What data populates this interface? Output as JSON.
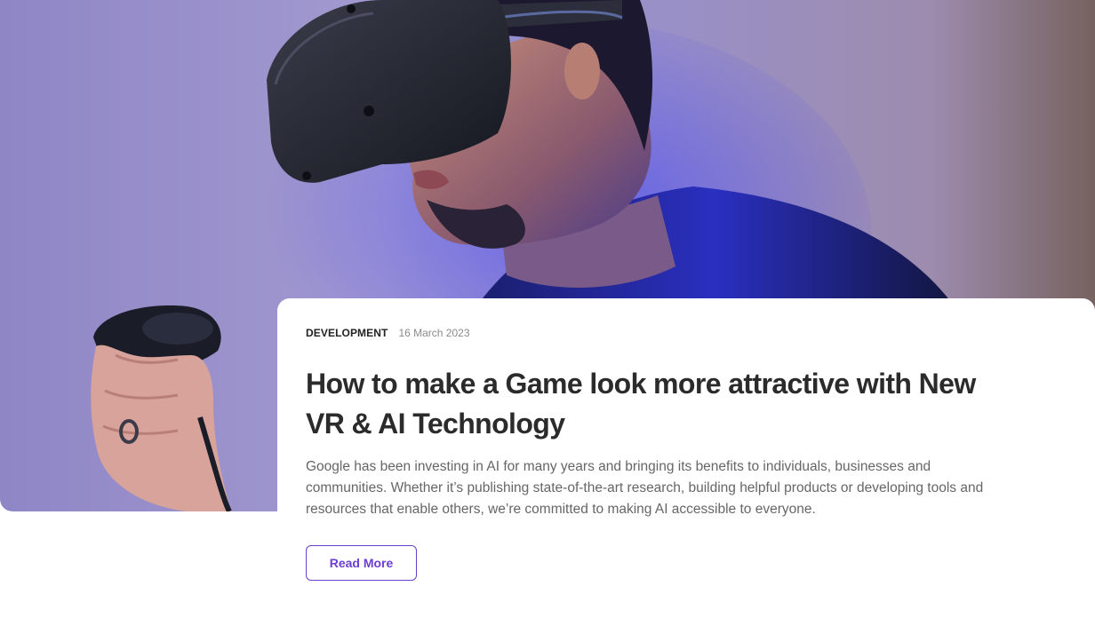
{
  "hero": {
    "image_description": "vr-headset-person-photo"
  },
  "post": {
    "category": "DEVELOPMENT",
    "date": "16 March 2023",
    "title": "How to make a Game look more attractive with New VR & AI Technology",
    "excerpt": "Google has been investing in AI for many years and bringing its benefits to individuals, businesses and communities. Whether it’s publishing state-of-the-art research, building helpful products or developing tools and resources that enable others, we’re committed to making AI accessible to everyone.",
    "read_more_label": "Read More"
  },
  "colors": {
    "accent": "#6c3fd1",
    "title": "#2b2b2b",
    "body": "#666666",
    "date": "#8a8a8a"
  }
}
